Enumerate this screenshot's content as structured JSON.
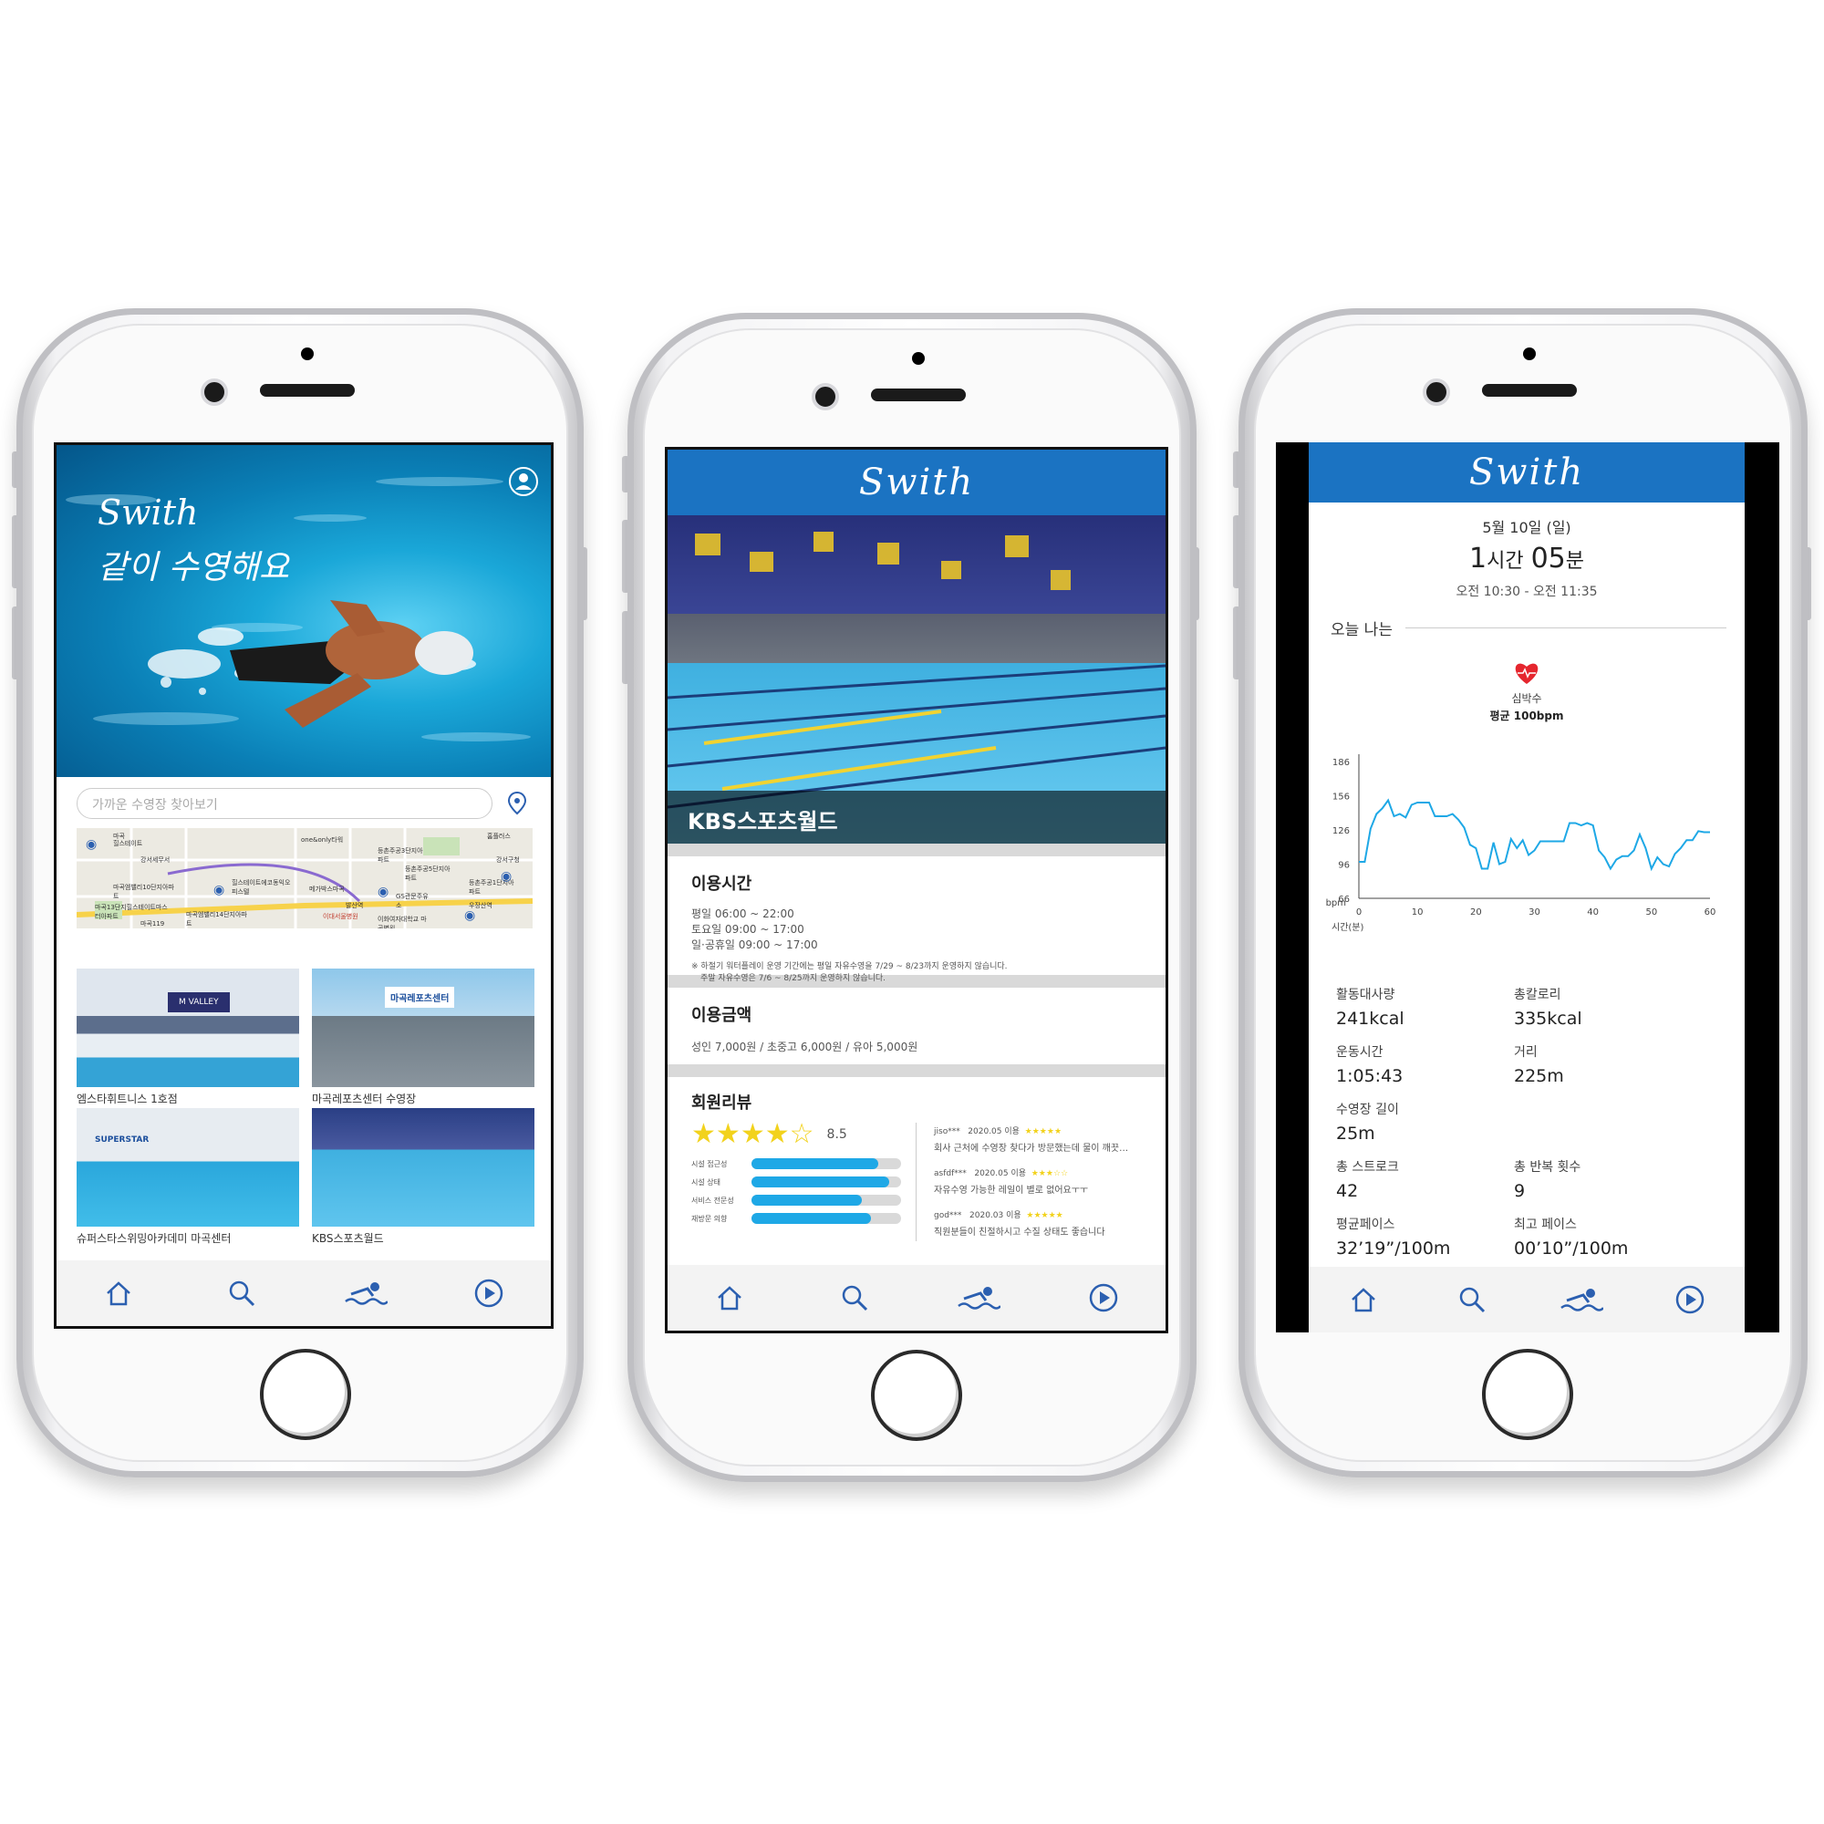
{
  "phone1": {
    "hero": {
      "brand": "Swith",
      "slogan": "같이 수영해요"
    },
    "search": {
      "placeholder": "가까운 수영장 찾아보기"
    },
    "map_labels": [
      "마곡",
      "힐스테이트",
      "one&only타워",
      "강서세무서",
      "마곡엠밸리10단지아파트",
      "힐스테이트에코동익오피스텔",
      "메가박스마곡",
      "발산역",
      "등촌주공3단지아파트",
      "등촌주공5단지아파트",
      "마곡13단지힐스테이트마스터아파트",
      "마곡엠밸리14단지아파트",
      "이대서울병원",
      "이화여자대학교 마곡병원",
      "GS관문주유소",
      "우장산역",
      "마곡119",
      "등촌주공1단지아파트",
      "강서구청",
      "홈플러스"
    ],
    "pools": [
      {
        "name": "엠스타휘트니스 1호점",
        "sign": "M VALLEY"
      },
      {
        "name": "마곡레포츠센터 수영장",
        "sign": "마곡레포츠센터"
      },
      {
        "name": "슈퍼스타스위밍아카데미 마곡센터",
        "sign": "SUPERSTAR"
      },
      {
        "name": "KBS스포츠월드",
        "sign": ""
      }
    ]
  },
  "phone2": {
    "brand": "Swith",
    "pool_name": "KBS스포츠월드",
    "hours": {
      "title": "이용시간",
      "lines": [
        "평일 06:00 ~ 22:00",
        "토요일 09:00 ~ 17:00",
        "일·공휴일 09:00 ~ 17:00"
      ],
      "note1": "※ 하절기 워터플레이 운영 기간에는 평일 자유수영을 7/29 ~ 8/23까지 운영하지 않습니다.",
      "note2": "주말 자유수영은 7/6 ~ 8/25까지 운영하지 않습니다."
    },
    "price": {
      "title": "이용금액",
      "text": "성인 7,000원 / 초중고 6,000원 / 유아 5,000원"
    },
    "reviews": {
      "title": "회원리뷰",
      "rating": "8.5",
      "stars_filled": 4,
      "stars_total": 5,
      "bars": [
        {
          "label": "시설 접근성",
          "value": 0.85
        },
        {
          "label": "시설 상태",
          "value": 0.92
        },
        {
          "label": "서비스 전문성",
          "value": 0.74
        },
        {
          "label": "재방문 의향",
          "value": 0.8
        }
      ],
      "items": [
        {
          "user": "jiso***",
          "date": "2020.05 이용",
          "text": "회사 근처에 수영장 찾다가 방문했는데 물이 깨끗…"
        },
        {
          "user": "asfdf***",
          "date": "2020.05 이용",
          "text": "자유수영 가능한 레일이 별로 없어요ㅜㅜ"
        },
        {
          "user": "god***",
          "date": "2020.03 이용",
          "text": "직원분들이 친절하시고 수질 상태도 좋습니다"
        }
      ]
    }
  },
  "phone3": {
    "brand": "Swith",
    "date": "5월 10일 (일)",
    "duration": {
      "h": "1",
      "h_unit": "시간",
      "m": "05",
      "m_unit": "분"
    },
    "range": "오전 10:30 - 오전 11:35",
    "section": "오늘 나는",
    "hr_label": "심박수",
    "hr_avg": "평균 100bpm",
    "stats": [
      {
        "label": "활동대사량",
        "value": "241kcal"
      },
      {
        "label": "총칼로리",
        "value": "335kcal"
      },
      {
        "label": "운동시간",
        "value": "1:05:43"
      },
      {
        "label": "거리",
        "value": "225m"
      },
      {
        "label": "수영장 길이",
        "value": "25m"
      },
      {
        "label": "총 스트로크",
        "value": "42"
      },
      {
        "label": "총 반복 횟수",
        "value": "9"
      },
      {
        "label": "평균페이스",
        "value": "32’19”/100m"
      },
      {
        "label": "최고 페이스",
        "value": "00’10”/100m"
      }
    ]
  },
  "nav_icons": [
    "home-icon",
    "search-icon",
    "swimmer-icon",
    "play-icon"
  ],
  "colors": {
    "brand_blue": "#1b73c2",
    "accent_cyan": "#1ea8e6",
    "heart_red": "#e5262e",
    "star_yellow": "#f2d21c"
  },
  "chart_data": {
    "type": "line",
    "title": "",
    "xlabel": "시간(분)",
    "ylabel": "bpm",
    "xlim": [
      0,
      60
    ],
    "ylim": [
      66,
      186
    ],
    "y_ticks": [
      186,
      156,
      126,
      96,
      66
    ],
    "x_ticks": [
      0,
      10,
      20,
      30,
      40,
      50,
      60
    ],
    "grid": false,
    "series": [
      {
        "x": [
          0,
          1,
          2,
          3,
          4,
          5,
          6,
          7,
          8,
          9,
          10,
          11,
          12,
          13,
          14,
          15,
          16,
          17,
          18,
          19,
          20,
          21,
          22,
          23,
          24,
          25,
          26,
          27,
          28,
          29,
          30,
          31,
          32,
          33,
          34,
          35,
          36,
          37,
          38,
          39,
          40,
          41,
          42,
          43,
          44,
          45,
          46,
          47,
          48,
          49,
          50,
          51,
          52,
          53,
          54,
          55,
          56,
          57,
          58,
          59,
          60
        ],
        "y": [
          98,
          98,
          127,
          140,
          145,
          152,
          138,
          140,
          137,
          148,
          150,
          150,
          150,
          138,
          138,
          138,
          140,
          135,
          128,
          113,
          110,
          92,
          92,
          115,
          96,
          98,
          118,
          110,
          117,
          104,
          108,
          116,
          116,
          116,
          116,
          116,
          132,
          132,
          130,
          132,
          130,
          108,
          102,
          92,
          100,
          103,
          103,
          108,
          122,
          110,
          92,
          102,
          96,
          94,
          105,
          110,
          117,
          117,
          125,
          124,
          124
        ]
      }
    ]
  }
}
